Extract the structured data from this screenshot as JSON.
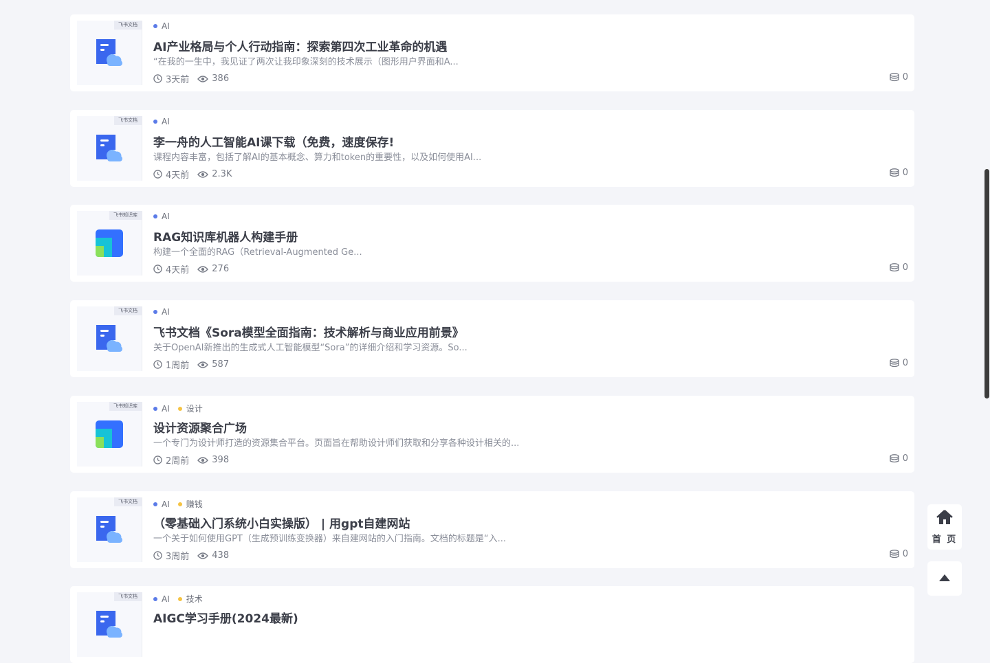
{
  "colors": {
    "background": "#f4f5f9",
    "card": "#ffffff",
    "category_dot_ai": "#5b7be8",
    "category_dot_other": "#f5c343",
    "feishu_doc_blue": "#3a67ee"
  },
  "articles": [
    {
      "source_tag": "飞书文档",
      "icon": "feishu-doc-icon",
      "categories": [
        {
          "label": "AI",
          "dot": "#5b7be8"
        }
      ],
      "title": "AI产业格局与个人行动指南：探索第四次工业革命的机遇",
      "description": "“在我的一生中，我见证了两次让我印象深刻的技术展示（图形用户界面和A...",
      "time": "3天前",
      "views": "386",
      "coins": "0"
    },
    {
      "source_tag": "飞书文档",
      "icon": "feishu-doc-icon",
      "categories": [
        {
          "label": "AI",
          "dot": "#5b7be8"
        }
      ],
      "title": "李一舟的人工智能AI课下载（免费，速度保存!",
      "description": "课程内容丰富，包括了解AI的基本概念、算力和token的重要性，以及如何使用AI...",
      "time": "4天前",
      "views": "2.3K",
      "coins": "0"
    },
    {
      "source_tag": "飞书知识库",
      "icon": "feishu-wiki-icon",
      "categories": [
        {
          "label": "AI",
          "dot": "#5b7be8"
        }
      ],
      "title": "RAG知识库机器人构建手册",
      "description": "  构建一个全面的RAG（Retrieval-Augmented Ge...",
      "time": "4天前",
      "views": "276",
      "coins": "0"
    },
    {
      "source_tag": "飞书文档",
      "icon": "feishu-doc-icon",
      "categories": [
        {
          "label": "AI",
          "dot": "#5b7be8"
        }
      ],
      "title": "飞书文档《Sora模型全面指南：技术解析与商业应用前景》",
      "description": "关于OpenAI新推出的生成式人工智能模型“Sora”的详细介绍和学习资源。So...",
      "time": "1周前",
      "views": "587",
      "coins": "0"
    },
    {
      "source_tag": "飞书知识库",
      "icon": "feishu-wiki-icon",
      "categories": [
        {
          "label": "AI",
          "dot": "#5b7be8"
        },
        {
          "label": "设计",
          "dot": "#f5c343"
        }
      ],
      "title": "设计资源聚合广场",
      "description": "一个专门为设计师打造的资源集合平台。页面旨在帮助设计师们获取和分享各种设计相关的...",
      "time": "2周前",
      "views": "398",
      "coins": "0"
    },
    {
      "source_tag": "飞书文档",
      "icon": "feishu-doc-icon",
      "categories": [
        {
          "label": "AI",
          "dot": "#5b7be8"
        },
        {
          "label": "赚钱",
          "dot": "#f5c343"
        }
      ],
      "title": "（零基础入门系统小白实操版） | 用gpt自建网站",
      "description": "一个关于如何使用GPT（生成预训练变换器）来自建网站的入门指南。文档的标题是“入...",
      "time": "3周前",
      "views": "438",
      "coins": "0"
    },
    {
      "source_tag": "飞书文档",
      "icon": "feishu-doc-icon",
      "categories": [
        {
          "label": "AI",
          "dot": "#5b7be8"
        },
        {
          "label": "技术",
          "dot": "#f5c343"
        }
      ],
      "title": "AIGC学习手册(2024最新)",
      "description": "",
      "time": "",
      "views": "",
      "coins": ""
    }
  ],
  "floating": {
    "home_label": "首 页",
    "home_icon": "home-icon",
    "top_icon": "caret-up-icon"
  }
}
